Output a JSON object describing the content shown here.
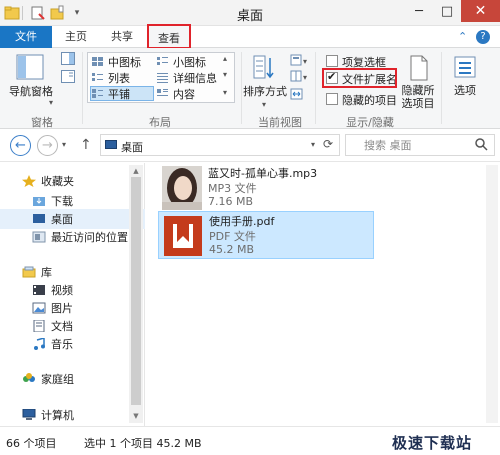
{
  "window": {
    "title": "桌面",
    "minimize_glyph": "─",
    "maximize_glyph": "□",
    "close_glyph": "✕"
  },
  "tabs": {
    "file": "文件",
    "home": "主页",
    "share": "共享",
    "view": "查看",
    "collapse_glyph": "⌃",
    "help_glyph": "?"
  },
  "ribbon": {
    "panes": {
      "nav_pane": "导航窗格",
      "group": "窗格"
    },
    "layout": {
      "medium_icons": "中图标",
      "small_icons": "小图标",
      "list": "列表",
      "details": "详细信息",
      "tiles": "平铺",
      "content": "内容",
      "group": "布局"
    },
    "current_view": {
      "sort_by": "排序方式",
      "group": "当前视图"
    },
    "show_hide": {
      "item_checkboxes": "项复选框",
      "file_extensions": "文件扩展名",
      "hidden_items": "隐藏的项目",
      "hide_selected_line1": "隐藏所",
      "hide_selected_line2": "选项目",
      "group": "显示/隐藏",
      "file_extensions_checked": true,
      "item_checkboxes_checked": false,
      "hidden_items_checked": false
    },
    "options": "选项"
  },
  "address": {
    "path": "桌面",
    "search_placeholder": "搜索 桌面"
  },
  "nav": {
    "favorites": "收藏夹",
    "downloads": "下载",
    "desktop": "桌面",
    "recent": "最近访问的位置",
    "libraries": "库",
    "videos": "视频",
    "pictures": "图片",
    "documents": "文档",
    "music": "音乐",
    "homegroup": "家庭组",
    "computer": "计算机"
  },
  "files": [
    {
      "name": "蓝又时-孤单心事.mp3",
      "type": "MP3 文件",
      "size": "7.16 MB"
    },
    {
      "name": "使用手册.pdf",
      "type": "PDF 文件",
      "size": "45.2 MB"
    }
  ],
  "status": {
    "item_count": "66 个项目",
    "selection": "选中 1 个项目  45.2 MB"
  },
  "watermark": "极速下载站",
  "colors": {
    "accent": "#1a76c5",
    "highlight_red": "#e0232b",
    "selection_fill": "#cce8ff",
    "close_red": "#c7463a",
    "pdf_red": "#c43b1c"
  }
}
